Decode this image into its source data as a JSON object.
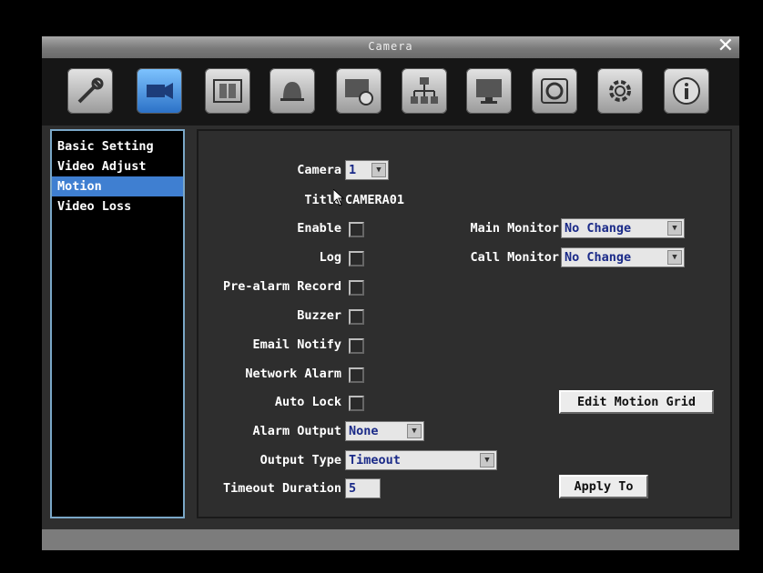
{
  "window": {
    "title": "Camera",
    "close": "✕"
  },
  "toolbar": {
    "buttons": [
      {
        "icon": "wrench-icon"
      },
      {
        "icon": "camera-icon"
      },
      {
        "icon": "film-icon"
      },
      {
        "icon": "bell-icon"
      },
      {
        "icon": "record-icon"
      },
      {
        "icon": "network-icon"
      },
      {
        "icon": "monitor-icon"
      },
      {
        "icon": "disk-icon"
      },
      {
        "icon": "gear-icon"
      },
      {
        "icon": "info-icon"
      }
    ],
    "active_index": 1
  },
  "sidebar": {
    "items": [
      {
        "label": "Basic Setting"
      },
      {
        "label": "Video Adjust"
      },
      {
        "label": "Motion"
      },
      {
        "label": "Video Loss"
      }
    ],
    "selected": "Motion"
  },
  "form": {
    "camera_label": "Camera",
    "camera_value": "1",
    "title_label": "Title",
    "title_value": "CAMERA01",
    "enable_label": "Enable",
    "log_label": "Log",
    "prealarm_label": "Pre-alarm Record",
    "buzzer_label": "Buzzer",
    "email_label": "Email Notify",
    "network_alarm_label": "Network Alarm",
    "auto_lock_label": "Auto Lock",
    "alarm_output_label": "Alarm Output",
    "alarm_output_value": "None",
    "output_type_label": "Output Type",
    "output_type_value": "Timeout",
    "timeout_label": "Timeout Duration",
    "timeout_value": "5",
    "main_monitor_label": "Main Monitor",
    "main_monitor_value": "No Change",
    "call_monitor_label": "Call Monitor",
    "call_monitor_value": "No Change",
    "edit_motion_grid": "Edit Motion Grid",
    "apply_to": "Apply To"
  },
  "colors": {
    "accent": "#3f7fd1",
    "select_text": "#1a2a88",
    "border": "#7aa7c7"
  }
}
